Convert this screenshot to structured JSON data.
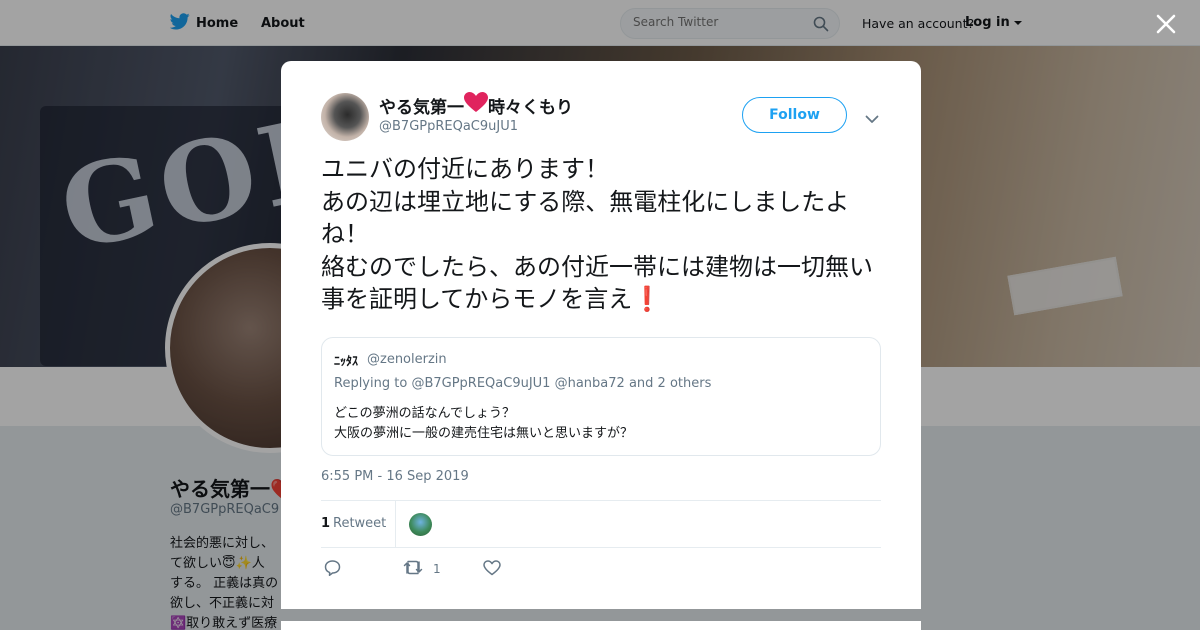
{
  "nav": {
    "home_label": "Home",
    "about_label": "About",
    "search_placeholder": "Search Twitter",
    "have_account": "Have an account?",
    "login_label": "Log in"
  },
  "profile": {
    "name": "やる気第一❤️時々くもり",
    "handle": "@B7GPpREQaC9",
    "bio": "社会的悪に対し、\nて欲しい😇✨人\nする。 正義は真の\n欲し、不正義に対\n🔯取り敢えず医療業界🎀🧸"
  },
  "tweet": {
    "author_name": "やる気第一",
    "author_name_suffix": "時々くもり",
    "author_handle": "@B7GPpREQaC9uJU1",
    "follow_label": "Follow",
    "text": "ユニバの付近にあります！\nあの辺は埋立地にする際、無電柱化にしましたよね！\n絡むのでしたら、あの付近一帯には建物は一切無い事を証明してからモノを言え",
    "text_end_emoji": "❗",
    "quote": {
      "author_name": "ﾆｯﾀｽ",
      "author_handle": "@zenolerzin",
      "replying_prefix": "Replying to",
      "replying_handle_1": "@B7GPpREQaC9uJU1",
      "replying_handle_2": "@hanba72",
      "replying_suffix": "and 2 others",
      "text": "どこの夢洲の話なんでしょう？\n大阪の夢洲に一般の建売住宅は無いと思いますが？"
    },
    "timestamp": "6:55 PM - 16 Sep 2019",
    "retweet_count": "1",
    "retweet_label": "Retweet",
    "action_retweet_count": "1"
  },
  "colors": {
    "accent": "#1da1f2",
    "heart": "#e0245e",
    "secondary_text": "#657786"
  }
}
